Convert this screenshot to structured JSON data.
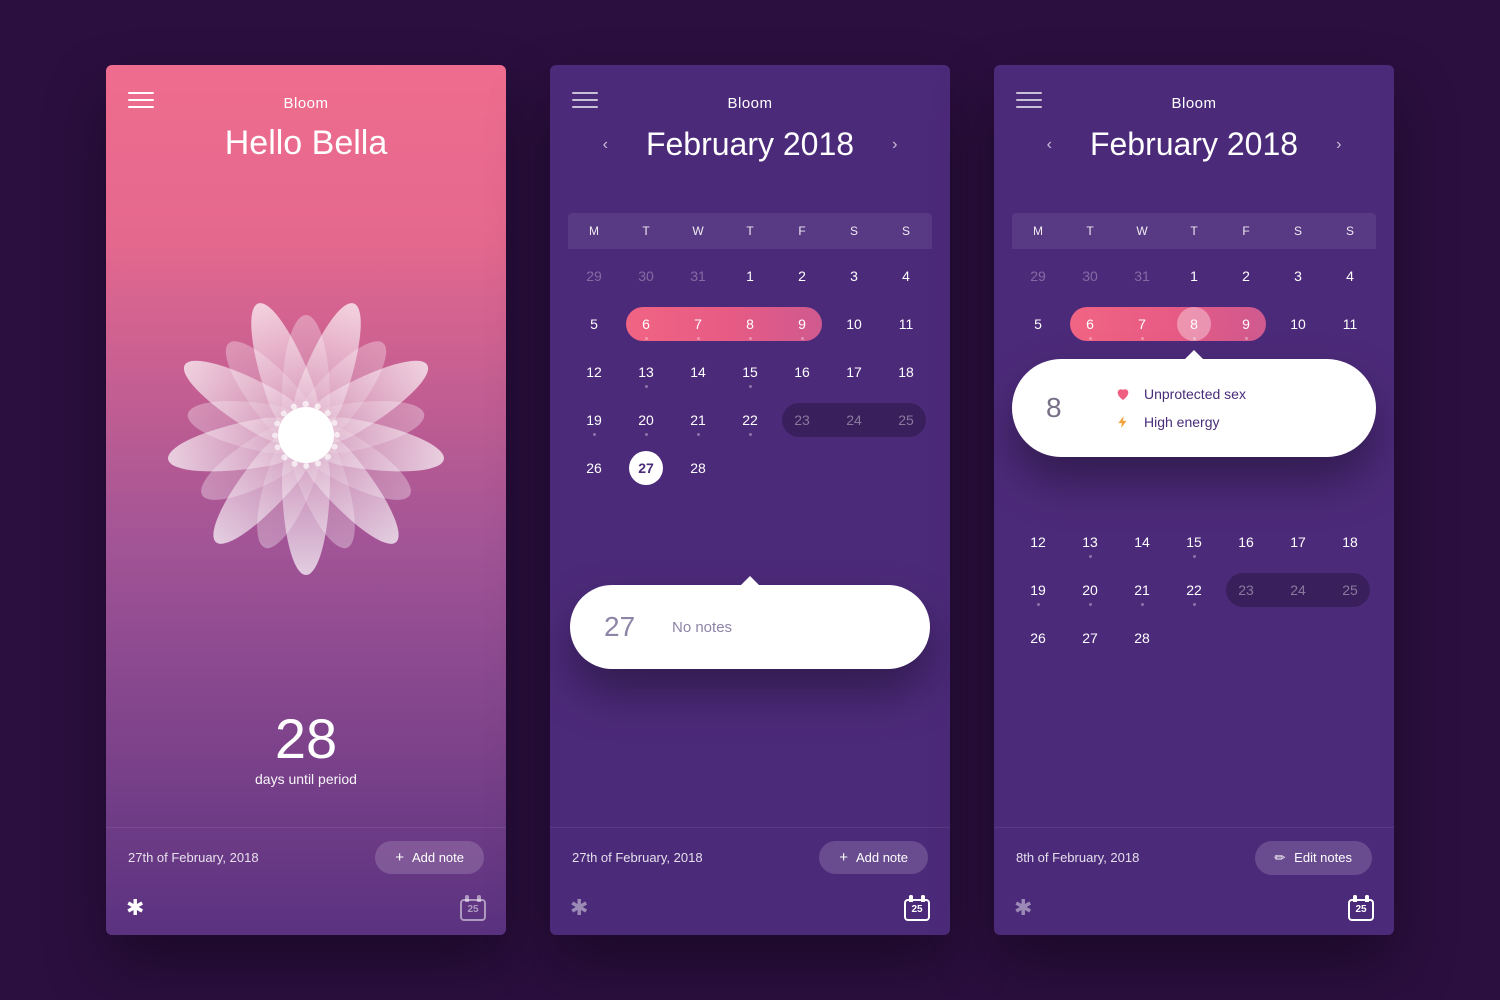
{
  "app": {
    "name": "Bloom"
  },
  "home": {
    "greeting": "Hello Bella",
    "countdown_number": "28",
    "countdown_label": "days until period",
    "date_label": "27th of February, 2018",
    "add_note": "Add note",
    "cal_badge": "25"
  },
  "cal": {
    "month_title": "February 2018",
    "dow": [
      "M",
      "T",
      "W",
      "T",
      "F",
      "S",
      "S"
    ],
    "weeks": [
      [
        {
          "n": "29",
          "out": true
        },
        {
          "n": "30",
          "out": true
        },
        {
          "n": "31",
          "out": true
        },
        {
          "n": "1"
        },
        {
          "n": "2"
        },
        {
          "n": "3"
        },
        {
          "n": "4"
        }
      ],
      [
        {
          "n": "5"
        },
        {
          "n": "6",
          "p": true,
          "dot": true
        },
        {
          "n": "7",
          "p": true,
          "dot": true
        },
        {
          "n": "8",
          "p": true,
          "dot": true
        },
        {
          "n": "9",
          "p": true,
          "dot": true
        },
        {
          "n": "10"
        },
        {
          "n": "11"
        }
      ],
      [
        {
          "n": "12"
        },
        {
          "n": "13",
          "dot": true
        },
        {
          "n": "14"
        },
        {
          "n": "15",
          "dot": true
        },
        {
          "n": "16"
        },
        {
          "n": "17"
        },
        {
          "n": "18"
        }
      ],
      [
        {
          "n": "19",
          "dot": true
        },
        {
          "n": "20",
          "dot": true
        },
        {
          "n": "21",
          "dot": true
        },
        {
          "n": "22",
          "dot": true
        },
        {
          "n": "23",
          "dim": true,
          "dp": true
        },
        {
          "n": "24",
          "dim": true,
          "dp": true
        },
        {
          "n": "25",
          "dim": true,
          "dp": true
        }
      ],
      [
        {
          "n": "26"
        },
        {
          "n": "27",
          "today": true
        },
        {
          "n": "28"
        },
        {
          "n": "",
          "out": true
        },
        {
          "n": "",
          "out": true
        },
        {
          "n": "",
          "out": true
        },
        {
          "n": "",
          "out": true
        }
      ]
    ]
  },
  "screen2": {
    "date_label": "27th of February, 2018",
    "add_note": "Add note",
    "cal_badge": "25",
    "popover": {
      "day": "27",
      "message": "No notes"
    }
  },
  "screen3": {
    "date_label": "8th of February, 2018",
    "edit_notes": "Edit notes",
    "cal_badge": "25",
    "popover": {
      "day": "8",
      "notes": [
        {
          "icon": "heart",
          "text": "Unprotected sex"
        },
        {
          "icon": "bolt",
          "text": "High energy"
        }
      ]
    }
  }
}
